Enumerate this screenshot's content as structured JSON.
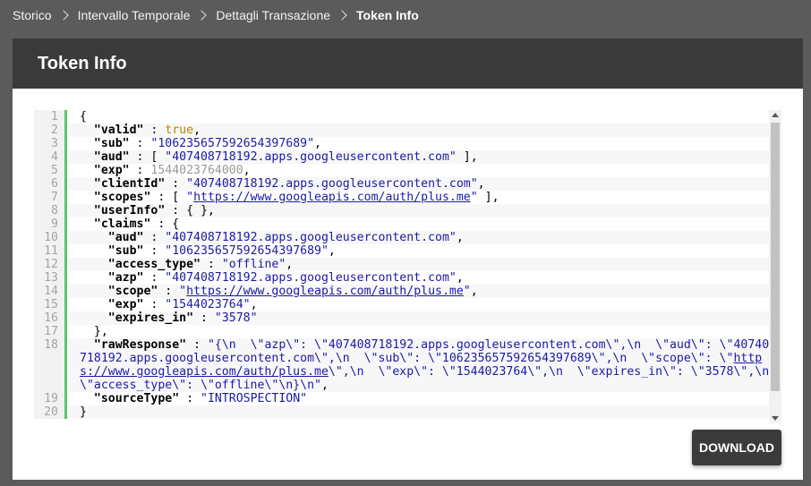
{
  "breadcrumb": {
    "items": [
      "Storico",
      "Intervallo Temporale",
      "Dettagli Transazione"
    ],
    "current": "Token Info"
  },
  "header": {
    "title": "Token Info"
  },
  "download_label": "DOWNLOAD",
  "code": {
    "line_numbers": [
      "1",
      "2",
      "3",
      "4",
      "5",
      "6",
      "7",
      "8",
      "9",
      "10",
      "11",
      "12",
      "13",
      "14",
      "15",
      "16",
      "17",
      "18",
      "19",
      "20"
    ],
    "open_brace": "{",
    "valid_key": "\"valid\"",
    "valid_val": "true",
    "sub_key": "\"sub\"",
    "sub_val": "\"106235657592654397689\"",
    "aud_key": "\"aud\"",
    "aud_val": "\"407408718192.apps.googleusercontent.com\"",
    "exp_key": "\"exp\"",
    "exp_val": "1544023764000",
    "clientId_key": "\"clientId\"",
    "clientId_val": "\"407408718192.apps.googleusercontent.com\"",
    "scopes_key": "\"scopes\"",
    "scopes_val": "https://www.googleapis.com/auth/plus.me",
    "userInfo_key": "\"userInfo\"",
    "userInfo_val": "{ }",
    "claims_key": "\"claims\"",
    "c_aud_key": "\"aud\"",
    "c_aud_val": "\"407408718192.apps.googleusercontent.com\"",
    "c_sub_key": "\"sub\"",
    "c_sub_val": "\"106235657592654397689\"",
    "c_access_type_key": "\"access_type\"",
    "c_access_type_val": "\"offline\"",
    "c_azp_key": "\"azp\"",
    "c_azp_val": "\"407408718192.apps.googleusercontent.com\"",
    "c_scope_key": "\"scope\"",
    "c_scope_val": "https://www.googleapis.com/auth/plus.me",
    "c_exp_key": "\"exp\"",
    "c_exp_val": "\"1544023764\"",
    "c_expires_in_key": "\"expires_in\"",
    "c_expires_in_val": "\"3578\"",
    "rawResponse_key": "\"rawResponse\"",
    "rawResponse_part1": "\"{\\n  \\\"azp\\\": \\\"407408718192.apps.googleusercontent.com\\\",\\n  \\\"aud\\\": \\\"407408718192.apps.googleusercontent.com\\\",\\n  \\\"sub\\\": \\\"106235657592654397689\\\",\\n  \\\"scope\\\": \\\"",
    "rawResponse_url": "https://www.googleapis.com/auth/plus.me",
    "rawResponse_part2": "\\\",\\n  \\\"exp\\\": \\\"1544023764\\\",\\n  \\\"expires_in\\\": \\\"3578\\\",\\n  \\\"access_type\\\": \\\"offline\\\"\\n}\\n\"",
    "sourceType_key": "\"sourceType\"",
    "sourceType_val": "\"INTROSPECTION\"",
    "close_brace": "}"
  }
}
